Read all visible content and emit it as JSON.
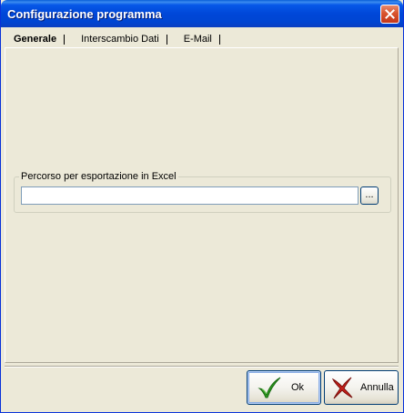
{
  "window": {
    "title": "Configurazione programma"
  },
  "tabs": [
    {
      "label": "Generale",
      "active": true
    },
    {
      "label": "Interscambio Dati",
      "active": false
    },
    {
      "label": "E-Mail",
      "active": false
    }
  ],
  "excel_export": {
    "group_label": "Percorso per esportazione in Excel",
    "path_value": "",
    "browse_label": "..."
  },
  "buttons": {
    "ok_label": "Ok",
    "cancel_label": "Annulla"
  },
  "icons": {
    "close": "close-icon",
    "ok": "checkmark-icon",
    "cancel": "cross-icon"
  },
  "colors": {
    "titlebar": "#0047D8",
    "dialog_bg": "#ECE9D8",
    "ok_check": "#2E9A1F",
    "cancel_cross": "#C8201A"
  }
}
